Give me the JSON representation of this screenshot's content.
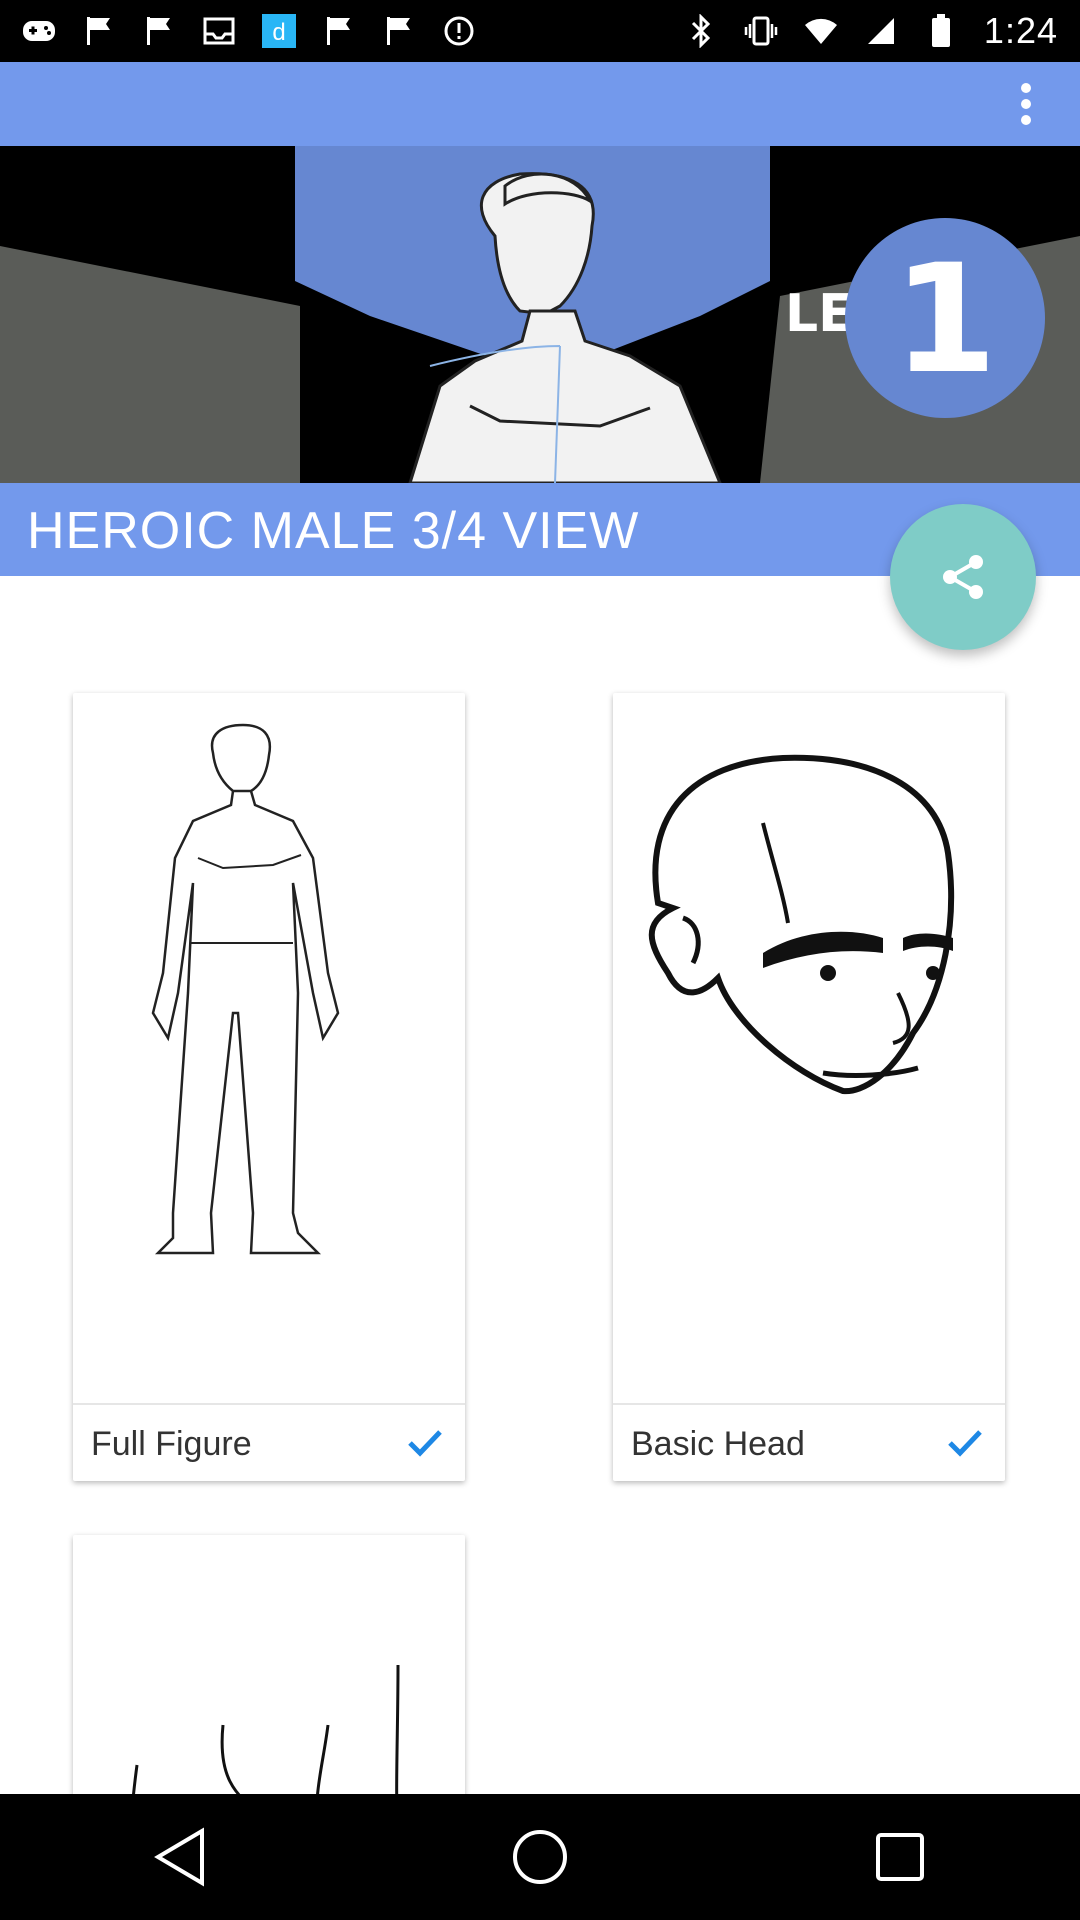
{
  "status_bar": {
    "time": "1:24",
    "left_icons": [
      "games-icon",
      "flag-icon",
      "flag-icon",
      "inbox-icon",
      "app-d-icon",
      "flag-icon",
      "flag-icon",
      "info-icon"
    ],
    "right_icons": [
      "bluetooth-icon",
      "vibrate-icon",
      "wifi-icon",
      "signal-icon",
      "battery-icon"
    ]
  },
  "hero": {
    "badge_text": "LEVEL",
    "badge_number": "1"
  },
  "title": "HEROIC MALE 3/4 VIEW",
  "cards": [
    {
      "label": "Full Figure",
      "checked": true
    },
    {
      "label": "Basic Head",
      "checked": true
    },
    {
      "label": "",
      "checked": false
    }
  ],
  "colors": {
    "primary": "#7399ec",
    "fab": "#7fccc7",
    "check": "#1e88e5"
  }
}
